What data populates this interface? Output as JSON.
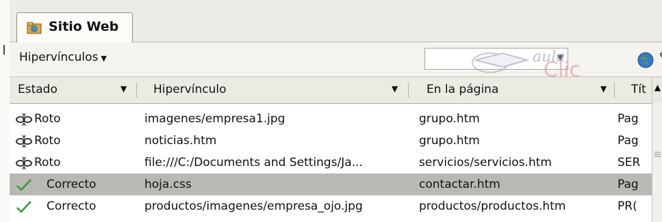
{
  "tab": {
    "label": "Sitio Web",
    "icon": "website-folder-icon"
  },
  "toolbar": {
    "view_dropdown_label": "Hipervínculos",
    "combo_value": "",
    "watermark_text": "aula Clic",
    "buttons": [
      {
        "icon": "globe-icon"
      },
      {
        "icon": "verify-hyperlinks-icon"
      }
    ]
  },
  "columns": [
    "Estado",
    "Hipervínculo",
    "En la página",
    "Tít"
  ],
  "rows": [
    {
      "status": "Roto",
      "icon": "broken-link-icon",
      "link": "imagenes/empresa1.jpg",
      "page": "grupo.htm",
      "title": "Pag"
    },
    {
      "status": "Roto",
      "icon": "broken-link-icon",
      "link": "noticias.htm",
      "page": "grupo.htm",
      "title": "Pag"
    },
    {
      "status": "Roto",
      "icon": "broken-link-icon",
      "link": "file:///C:/Documents and Settings/Ja...",
      "page": "servicios/servicios.htm",
      "title": "SER"
    },
    {
      "status": "Correcto",
      "icon": "checkmark-icon",
      "link": "hoja.css",
      "page": "contactar.htm",
      "title": "Pag",
      "selected": true
    },
    {
      "status": "Correcto",
      "icon": "checkmark-icon",
      "link": "productos/imagenes/empresa_ojo.jpg",
      "page": "productos/productos.htm",
      "title": "PR("
    }
  ],
  "colors": {
    "selected_row": "#b9b8b4",
    "check": "#2e9d2e"
  }
}
